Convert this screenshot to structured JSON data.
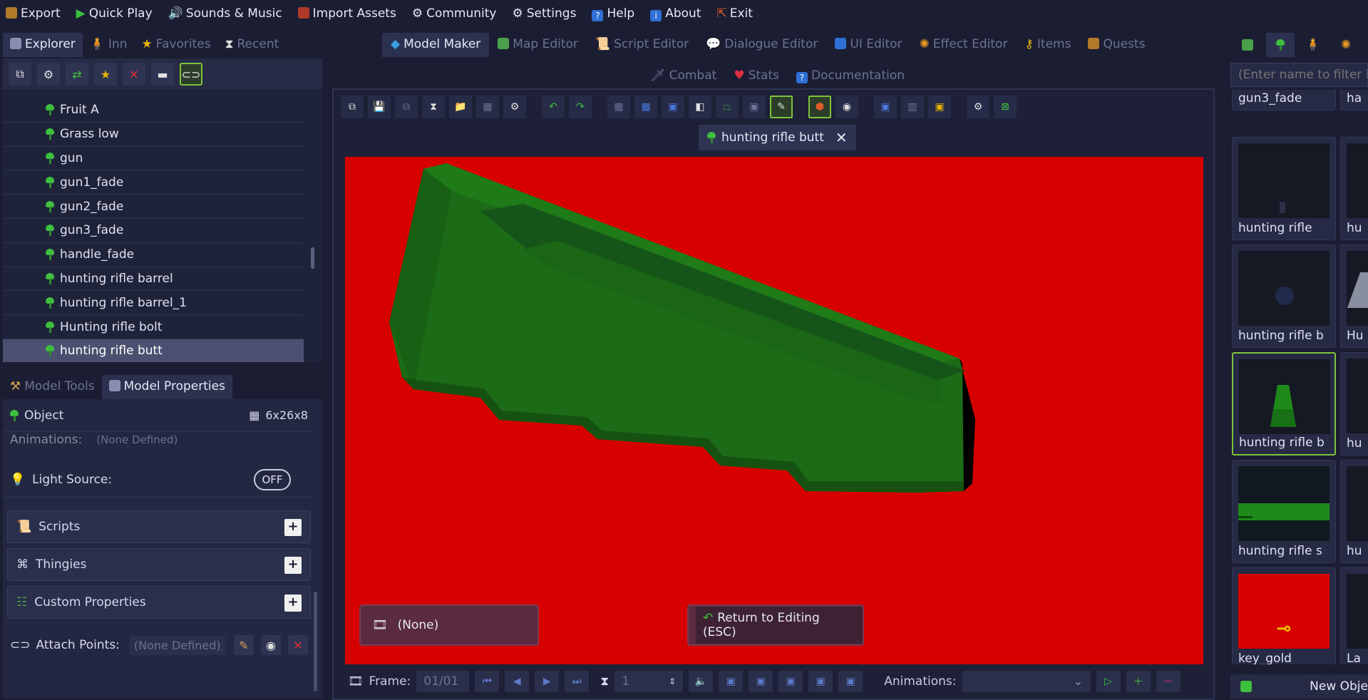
{
  "menu": [
    "Export",
    "Quick Play",
    "Sounds & Music",
    "Import Assets",
    "Community",
    "Settings",
    "Help",
    "About",
    "Exit"
  ],
  "left_tabs": [
    "Explorer",
    "Inn",
    "Favorites",
    "Recent"
  ],
  "explorer_items": [
    "Fruit A",
    "Grass low",
    "gun",
    "gun1_fade",
    "gun2_fade",
    "gun3_fade",
    "handle_fade",
    "hunting rifle barrel",
    "hunting rifle barrel_1",
    "Hunting rifle bolt",
    "hunting rifle butt"
  ],
  "props_tabs": [
    "Model Tools",
    "Model Properties"
  ],
  "props": {
    "object_label": "Object",
    "dimensions": "6x26x8",
    "animations_label": "Animations:",
    "animations_value": "(None Defined)",
    "light_source_label": "Light Source:",
    "light_toggle": "OFF",
    "scripts": "Scripts",
    "thingies": "Thingies",
    "custom_properties": "Custom Properties",
    "attach_points_label": "Attach Points:",
    "attach_points_value": "(None Defined)"
  },
  "main_tabs": [
    "Model Maker",
    "Map Editor",
    "Script Editor",
    "Dialogue Editor",
    "UI Editor",
    "Effect Editor",
    "Items",
    "Quests"
  ],
  "sub_tabs": [
    "Combat",
    "Stats",
    "Documentation"
  ],
  "model_tab": "hunting rifle butt",
  "canvas": {
    "animation_button": "(None)",
    "return_button": "Return to Editing (ESC)"
  },
  "bottom": {
    "frame_label": "Frame:",
    "frame_value": "01/01",
    "speed_value": "1",
    "animations_label": "Animations:"
  },
  "filter_placeholder": "(Enter name to filter by",
  "assets": [
    "gun3_fade",
    "hunting rifle",
    "hunting rifle b",
    "hunting rifle b",
    "hunting rifle s",
    "key_gold"
  ],
  "assets_col2": [
    "ha",
    "hu",
    "Hu",
    "hu",
    "hu",
    "La"
  ],
  "new_object": "New Obje",
  "colors": {
    "canvas_bg": "#d70000",
    "accent_green": "#7ec23a",
    "model_green": "#1c6b16"
  }
}
